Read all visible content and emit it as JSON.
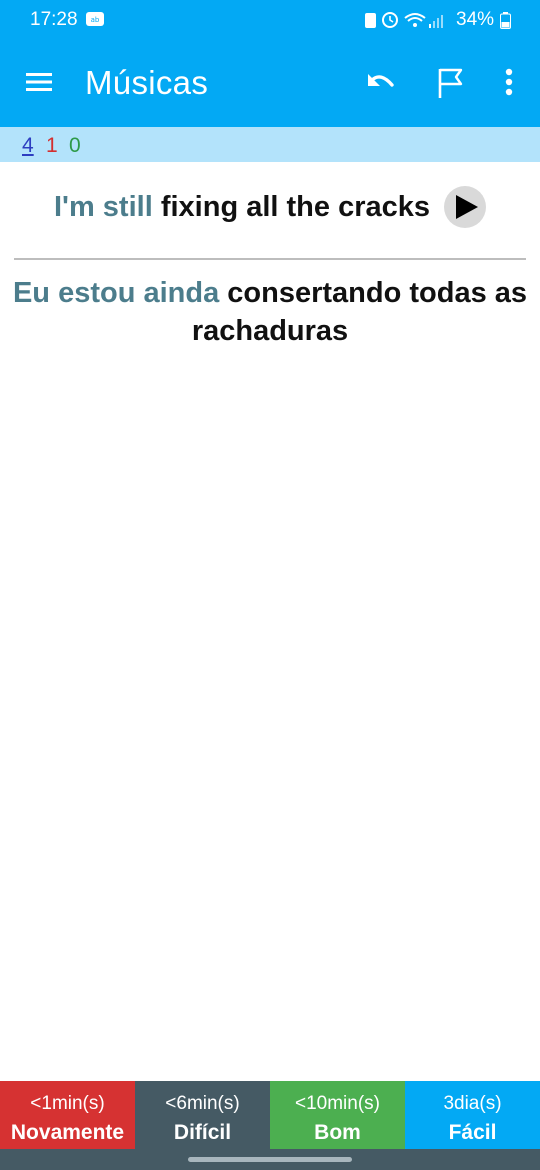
{
  "status_bar": {
    "time": "17:28",
    "battery": "34%"
  },
  "app_bar": {
    "title": "Músicas",
    "color": "#03a9f4"
  },
  "counts": {
    "new": "4",
    "learning": "1",
    "review": "0"
  },
  "card": {
    "question_known": "I'm still",
    "question_rest": "fixing all the cracks",
    "answer_known": "Eu estou ainda",
    "answer_rest": "consertando todas as rachaduras"
  },
  "answer_buttons": [
    {
      "time": "<1min(s)",
      "label": "Novamente",
      "color": "#d63232"
    },
    {
      "time": "<6min(s)",
      "label": "Difícil",
      "color": "#455a64"
    },
    {
      "time": "<10min(s)",
      "label": "Bom",
      "color": "#4caf50"
    },
    {
      "time": "3dia(s)",
      "label": "Fácil",
      "color": "#03a9f4"
    }
  ],
  "icons": {
    "menu": "hamburger-menu-icon",
    "undo": "undo-icon",
    "flag": "flag-icon",
    "more": "more-vertical-icon",
    "play": "play-icon"
  }
}
